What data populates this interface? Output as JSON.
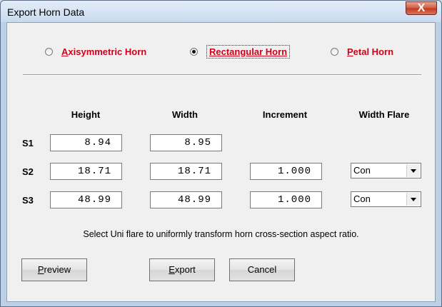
{
  "window": {
    "title": "Export Horn Data",
    "close_label": "X"
  },
  "horn_types": [
    {
      "mnemonic": "A",
      "rest": "xisymmetric Horn",
      "checked": false
    },
    {
      "mnemonic": "R",
      "rest": "ectangular Horn",
      "checked": true
    },
    {
      "mnemonic": "P",
      "rest": "etal Horn",
      "checked": false
    }
  ],
  "columns": {
    "height": "Height",
    "width": "Width",
    "increment": "Increment",
    "width_flare": "Width Flare"
  },
  "rows": [
    {
      "label": "S1",
      "height": "8.94",
      "width": "8.95"
    },
    {
      "label": "S2",
      "height": "18.71",
      "width": "18.71",
      "increment": "1.000",
      "flare": "Con"
    },
    {
      "label": "S3",
      "height": "48.99",
      "width": "48.99",
      "increment": "1.000",
      "flare": "Con"
    }
  ],
  "hint": "Select Uni flare to uniformly transform horn cross-section aspect ratio.",
  "buttons": {
    "preview": {
      "mnemonic": "P",
      "rest": "review"
    },
    "export": {
      "mnemonic": "E",
      "rest": "xport"
    },
    "cancel": "Cancel"
  }
}
